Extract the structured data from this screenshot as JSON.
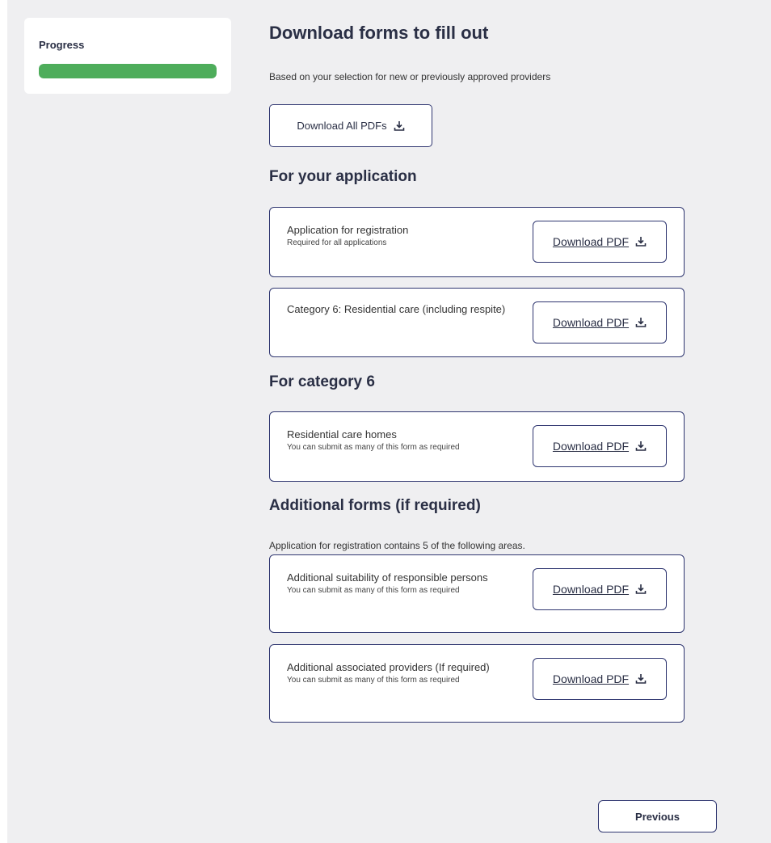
{
  "sidebar": {
    "progress_label": "Progress",
    "progress_value": 1.0,
    "progress_color": "#4ead5b"
  },
  "header": {
    "title": "Download forms to fill out",
    "subtitle": "Based on your selection for new or previously approved providers",
    "download_all_label": "Download All PDFs"
  },
  "sections": [
    {
      "title": "For your application",
      "note": "",
      "cards": [
        {
          "title": "Application for registration",
          "sub": "Required for all applications",
          "button": "Download PDF"
        },
        {
          "title": "Category 6: Residential care (including respite)",
          "sub": "",
          "button": "Download PDF"
        }
      ]
    },
    {
      "title": "For category 6",
      "note": "",
      "cards": [
        {
          "title": "Residential care homes",
          "sub": "You can submit as many of this form as required",
          "button": "Download PDF"
        }
      ]
    },
    {
      "title": "Additional forms (if required)",
      "note": "Application for registration contains 5 of the following areas.",
      "cards": [
        {
          "title": "Additional suitability of responsible persons",
          "sub": "You can submit as many of this form as required",
          "button": "Download PDF"
        },
        {
          "title": "Additional associated providers (If required)",
          "sub": "You can submit as many of this form as required",
          "button": "Download PDF"
        }
      ]
    }
  ],
  "footer": {
    "previous_label": "Previous"
  },
  "icons": {
    "download": "download-icon"
  },
  "colors": {
    "accent": "#2f3670",
    "background": "#efeff1"
  }
}
